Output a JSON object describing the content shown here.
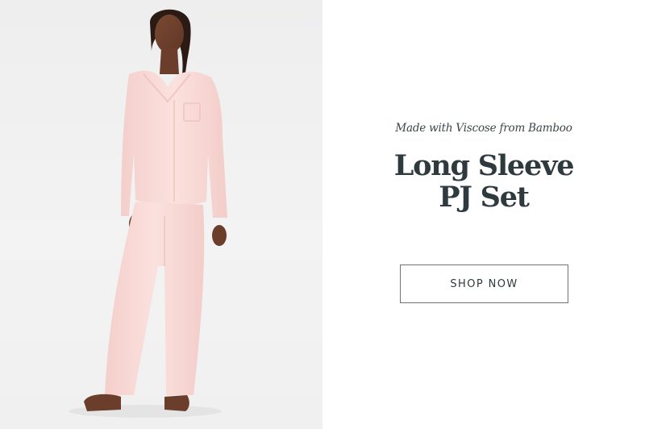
{
  "hero": {
    "image_alt": "Woman wearing a light pink long sleeve pajama set",
    "eyebrow": "Made with Viscose from Bamboo",
    "headline_lines": [
      "Long Sleeve",
      "PJ Set"
    ],
    "cta_label": "SHOP NOW"
  },
  "colors": {
    "garment": "#f9dad7",
    "background_photo": "#f0f0f0",
    "text": "#2f3a3e"
  }
}
